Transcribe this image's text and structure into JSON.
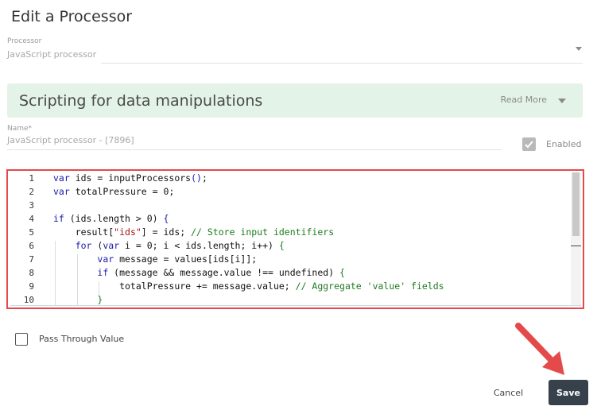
{
  "dialog": {
    "title": "Edit a Processor"
  },
  "processor_field": {
    "label": "Processor",
    "value": "JavaScript processor"
  },
  "banner": {
    "title": "Scripting for data manipulations",
    "read_more": "Read More"
  },
  "name_field": {
    "label": "Name*",
    "value": "JavaScript processor  - [7896]"
  },
  "enabled": {
    "label": "Enabled",
    "checked": true
  },
  "code_editor": {
    "line_numbers": [
      "1",
      "2",
      "3",
      "4",
      "5",
      "6",
      "7",
      "8",
      "9",
      "10"
    ]
  },
  "pass_through": {
    "label": "Pass Through Value",
    "checked": false
  },
  "footer": {
    "cancel_label": "Cancel",
    "save_label": "Save"
  },
  "colors": {
    "annotation_red": "#e54a4a",
    "banner_bg": "#e3f3e7",
    "save_bg": "#37414b"
  }
}
